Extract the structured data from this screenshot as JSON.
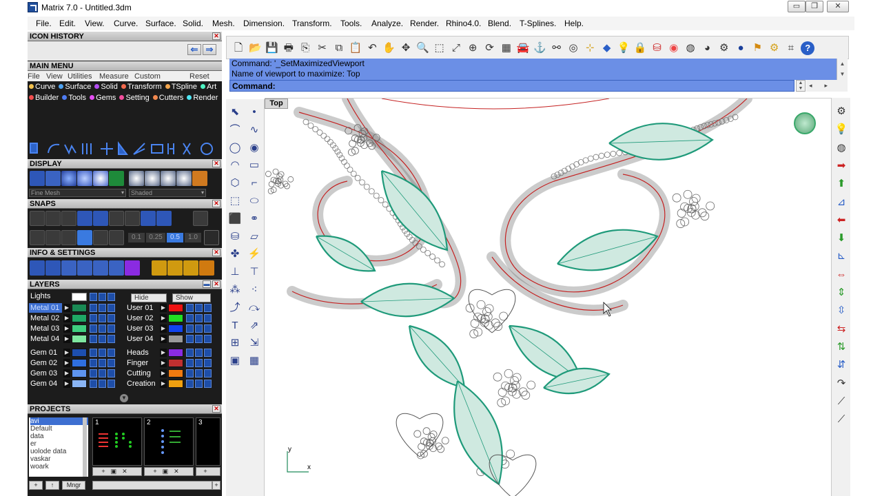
{
  "window": {
    "title": "Matrix 7.0 - Untitled.3dm",
    "min_glyph": "▭",
    "max_glyph": "❐",
    "close_glyph": "✕"
  },
  "menubar": [
    "File",
    "Edit",
    "View",
    "Curve",
    "Surface",
    "Solid",
    "Mesh",
    "Dimension",
    "Transform",
    "Tools",
    "Analyze",
    "Render",
    "Rhino4.0",
    "Blend",
    "T-Splines",
    "Help"
  ],
  "panels": {
    "icon_history": "ICON HISTORY",
    "main_menu": "MAIN MENU",
    "main_menu_items": [
      "File",
      "View",
      "Utilities",
      "Measure",
      "Custom"
    ],
    "main_menu_reset": "Reset",
    "categories_row1": [
      {
        "label": "Curve",
        "color": "#f2c14e"
      },
      {
        "label": "Surface",
        "color": "#4ea3f2"
      },
      {
        "label": "Solid",
        "color": "#b44ef2"
      },
      {
        "label": "Transform",
        "color": "#f26a4e"
      },
      {
        "label": "TSpline",
        "color": "#f2a64e"
      },
      {
        "label": "Art",
        "color": "#4ef2c2"
      }
    ],
    "categories_row2": [
      {
        "label": "Builder",
        "color": "#f24e4e"
      },
      {
        "label": "Tools",
        "color": "#4e7cf2"
      },
      {
        "label": "Gems",
        "color": "#e44ef2"
      },
      {
        "label": "Setting",
        "color": "#f24e9c"
      },
      {
        "label": "Cutters",
        "color": "#f2884e"
      },
      {
        "label": "Render",
        "color": "#4ee5f2"
      }
    ],
    "display": "DISPLAY",
    "display_mesh": "Fine Mesh",
    "display_mode": "Shaded",
    "snaps": "SNAPS",
    "snap_values": [
      "0.1",
      "0.25",
      "0.5",
      "1.0"
    ],
    "info_settings": "INFO & SETTINGS",
    "layers": "LAYERS",
    "layers_lights": "Lights",
    "layers_hide": "Hide",
    "layers_show": "Show",
    "projects": "PROJECTS",
    "mngr": "Mngr"
  },
  "layers_left": [
    {
      "name": "Metal 01",
      "color": "#1a8a55",
      "selected": true
    },
    {
      "name": "Metal 02",
      "color": "#1fa865",
      "selected": false
    },
    {
      "name": "Metal 03",
      "color": "#3fcf7f",
      "selected": false
    },
    {
      "name": "Metal 04",
      "color": "#7fe8a0",
      "selected": false
    },
    {
      "name": "Gem 01",
      "color": "#1d4fb0",
      "selected": false
    },
    {
      "name": "Gem 02",
      "color": "#2f6fe0",
      "selected": false
    },
    {
      "name": "Gem 03",
      "color": "#5e95f0",
      "selected": false
    },
    {
      "name": "Gem 04",
      "color": "#8ab5f5",
      "selected": false
    }
  ],
  "layers_right": [
    {
      "name": "User 01",
      "color": "#ee1111"
    },
    {
      "name": "User 02",
      "color": "#22dd22"
    },
    {
      "name": "User 03",
      "color": "#1144ee"
    },
    {
      "name": "User 04",
      "color": "#9a9a9a"
    },
    {
      "name": "Heads",
      "color": "#8a2be2"
    },
    {
      "name": "Finger",
      "color": "#c03030"
    },
    {
      "name": "Cutting",
      "color": "#f07a10"
    },
    {
      "name": "Creation",
      "color": "#f0a010"
    }
  ],
  "projects": {
    "list": [
      "avi",
      "Default",
      "data",
      "er",
      "uolode data",
      "vaskar",
      "woark"
    ],
    "selected": 0,
    "thumb_numbers": [
      "1",
      "2",
      "3"
    ]
  },
  "command": {
    "line1": "Command: '_SetMaximizedViewport",
    "line2": "Name of viewport to maximize: Top",
    "prompt": "Command:"
  },
  "viewport": {
    "name": "Top",
    "axis_y": "y",
    "axis_x": "x"
  },
  "colors": {
    "teal": "#1f9a7a",
    "red": "#c42020",
    "panel_dark": "#1c1c1c",
    "command_blue": "#6b8fe6"
  }
}
